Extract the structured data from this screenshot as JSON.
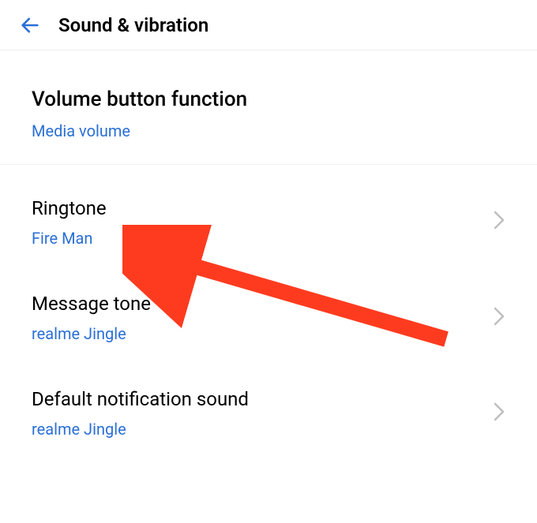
{
  "header": {
    "title": "Sound & vibration"
  },
  "volume_button": {
    "title": "Volume button function",
    "value": "Media volume"
  },
  "ringtone": {
    "title": "Ringtone",
    "value": "Fire Man"
  },
  "message_tone": {
    "title": "Message tone",
    "value": "realme Jingle"
  },
  "notification": {
    "title": "Default notification sound",
    "value": "realme Jingle"
  },
  "colors": {
    "accent": "#2a6fd6",
    "arrow": "#ff3b1f",
    "chevron": "#bfbfbf",
    "back": "#2a6fd6"
  }
}
